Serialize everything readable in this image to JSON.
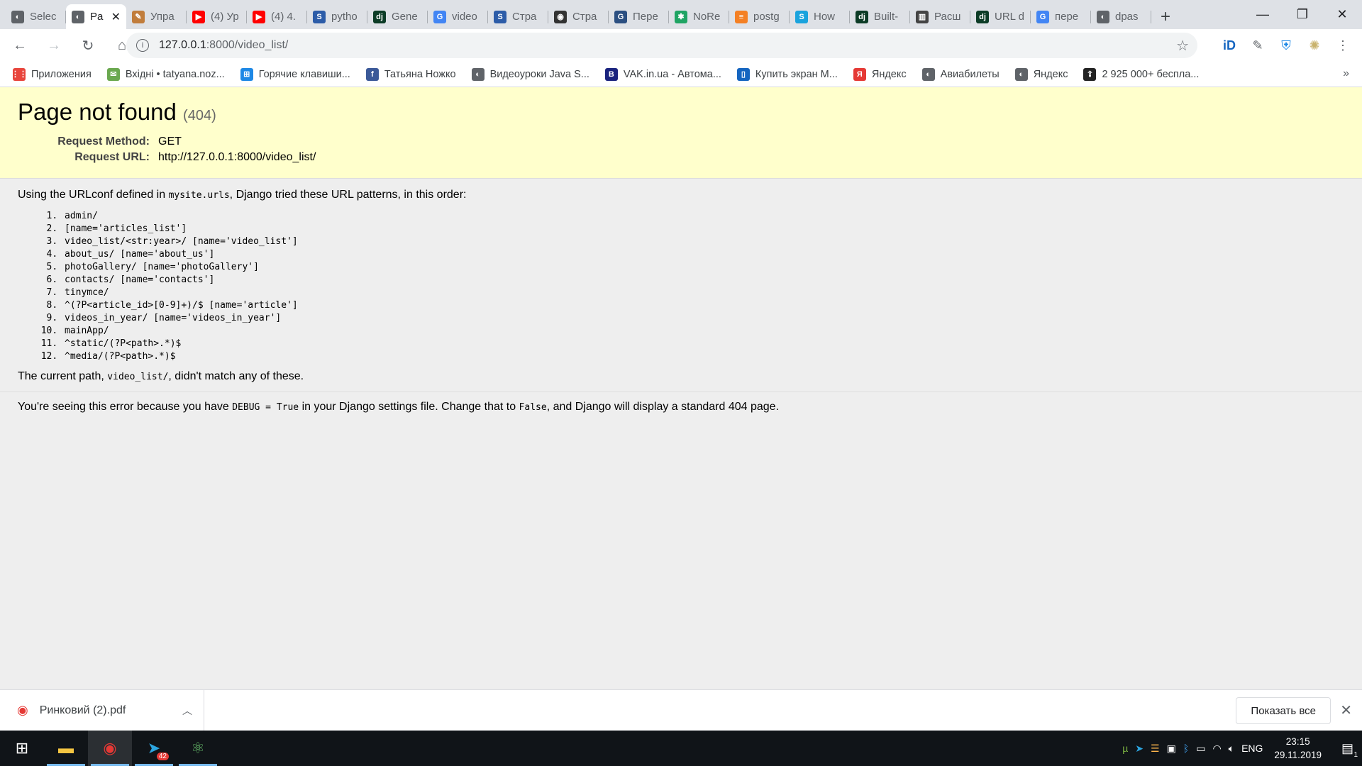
{
  "browser": {
    "tabs": [
      {
        "title": "Selec",
        "icon": "globe-icon",
        "color": "#5f6368",
        "glyph": "◐",
        "active": false
      },
      {
        "title": "Pa",
        "icon": "globe-icon",
        "color": "#5f6368",
        "glyph": "◐",
        "active": true
      },
      {
        "title": "Упра",
        "icon": "pen-icon",
        "color": "#c17d3c",
        "glyph": "✎",
        "active": false
      },
      {
        "title": "(4) Ур",
        "icon": "youtube-icon",
        "color": "#ff0000",
        "glyph": "▶",
        "active": false
      },
      {
        "title": "(4) 4.",
        "icon": "youtube-icon",
        "color": "#ff0000",
        "glyph": "▶",
        "active": false
      },
      {
        "title": "pytho",
        "icon": "stackoverflow-icon",
        "color": "#2c5ca8",
        "glyph": "S",
        "active": false
      },
      {
        "title": "Gene",
        "icon": "django-icon",
        "color": "#0c3c26",
        "glyph": "dj",
        "active": false
      },
      {
        "title": "video",
        "icon": "google-icon",
        "color": "#4285f4",
        "glyph": "G",
        "active": false
      },
      {
        "title": "Стра",
        "icon": "stackoverflow-icon",
        "color": "#2c5ca8",
        "glyph": "S",
        "active": false
      },
      {
        "title": "Стра",
        "icon": "glasses-icon",
        "color": "#333333",
        "glyph": "◉",
        "active": false
      },
      {
        "title": "Пере",
        "icon": "news-icon",
        "color": "#2b4f81",
        "glyph": "G",
        "active": false
      },
      {
        "title": "NoRe",
        "icon": "snowflake-icon",
        "color": "#1fa463",
        "glyph": "✱",
        "active": false
      },
      {
        "title": "postg",
        "icon": "stackoverflow-icon",
        "color": "#f48024",
        "glyph": "≡",
        "active": false
      },
      {
        "title": "How",
        "icon": "sitepoint-icon",
        "color": "#1aa3dd",
        "glyph": "S",
        "active": false
      },
      {
        "title": "Built-",
        "icon": "django-icon",
        "color": "#0c3c26",
        "glyph": "dj",
        "active": false
      },
      {
        "title": "Расш",
        "icon": "book-icon",
        "color": "#444444",
        "glyph": "▥",
        "active": false
      },
      {
        "title": "URL d",
        "icon": "django-icon",
        "color": "#0c3c26",
        "glyph": "dj",
        "active": false
      },
      {
        "title": "пере",
        "icon": "google-icon",
        "color": "#4285f4",
        "glyph": "G",
        "active": false
      },
      {
        "title": "dpas",
        "icon": "globe-icon",
        "color": "#5f6368",
        "glyph": "◐",
        "active": false
      }
    ],
    "newtab_glyph": "+",
    "window_controls": {
      "minimize": "—",
      "maximize": "❐",
      "close": "✕"
    },
    "url_host": "127.0.0.1",
    "url_path": ":8000/video_list/",
    "bookmarks": [
      {
        "label": "Приложения",
        "icon": "apps-grid-icon",
        "color": "#e8453c",
        "glyph": "⋮⋮"
      },
      {
        "label": "Вхідні • tatyana.noz...",
        "icon": "mail-icon",
        "color": "#6aa84f",
        "glyph": "✉"
      },
      {
        "label": "Горячие клавиши...",
        "icon": "windows-icon",
        "color": "#1e88e5",
        "glyph": "⊞"
      },
      {
        "label": "Татьяна Ножко",
        "icon": "facebook-icon",
        "color": "#3b5998",
        "glyph": "f"
      },
      {
        "label": "Видеоуроки Java S...",
        "icon": "globe-icon",
        "color": "#5f6368",
        "glyph": "◐"
      },
      {
        "label": "VAK.in.ua - Автома...",
        "icon": "vak-icon",
        "color": "#1a237e",
        "glyph": "B"
      },
      {
        "label": "Купить экран М...",
        "icon": "phone-icon",
        "color": "#1565c0",
        "glyph": "▯"
      },
      {
        "label": "Яндекс",
        "icon": "yandex-icon",
        "color": "#e53935",
        "glyph": "Я"
      },
      {
        "label": "Авиабилеты",
        "icon": "globe-icon",
        "color": "#5f6368",
        "glyph": "◐"
      },
      {
        "label": "Яндекс",
        "icon": "globe-icon",
        "color": "#5f6368",
        "glyph": "◐"
      },
      {
        "label": "2 925 000+ бесплa...",
        "icon": "upload-icon",
        "color": "#222222",
        "glyph": "⇪"
      }
    ],
    "bookmarks_more": "»"
  },
  "error_page": {
    "title": "Page not found",
    "code": "(404)",
    "request_method_label": "Request Method:",
    "request_method": "GET",
    "request_url_label": "Request URL:",
    "request_url": "http://127.0.0.1:8000/video_list/",
    "urlconf_prefix": "Using the URLconf defined in ",
    "urlconf_module": "mysite.urls",
    "urlconf_suffix": ", Django tried these URL patterns, in this order:",
    "patterns": [
      "admin/",
      "[name='articles_list']",
      "video_list/<str:year>/ [name='video_list']",
      "about_us/ [name='about_us']",
      "photoGallery/ [name='photoGallery']",
      "contacts/ [name='contacts']",
      "tinymce/",
      "^(?P<article_id>[0-9]+)/$ [name='article']",
      "videos_in_year/ [name='videos_in_year']",
      "mainApp/",
      "^static/(?P<path>.*)$",
      "^media/(?P<path>.*)$"
    ],
    "current_path_prefix": "The current path, ",
    "current_path": "video_list/",
    "current_path_suffix": ", didn't match any of these.",
    "explanation_prefix": "You're seeing this error because you have ",
    "debug_setting": "DEBUG = True",
    "explanation_middle": " in your Django settings file. Change that to ",
    "false_value": "False",
    "explanation_suffix": ", and Django will display a standard 404 page."
  },
  "download_bar": {
    "filename": "Ринковий (2).pdf",
    "show_all": "Показать все",
    "close_glyph": "✕"
  },
  "taskbar": {
    "telegram_badge": "42",
    "language": "ENG",
    "time": "23:15",
    "date": "29.11.2019",
    "notification_count": "1"
  }
}
